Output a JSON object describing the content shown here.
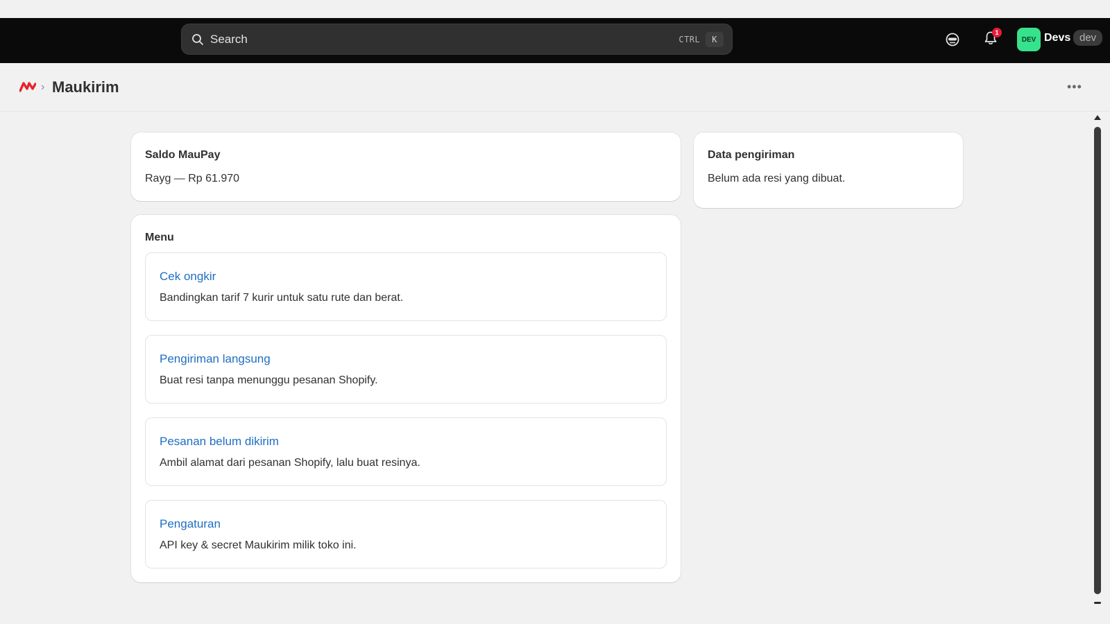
{
  "search": {
    "label": "Search",
    "shortcut_mod": "CTRL",
    "shortcut_key": "K"
  },
  "topbar": {
    "notification_count": "1",
    "avatar_initials": "DEV",
    "store_name": "Devs",
    "store_badge": "dev"
  },
  "app": {
    "title": "Maukirim",
    "breadcrumb_separator": "›",
    "more_menu": "•••"
  },
  "saldo": {
    "title": "Saldo MauPay",
    "value": "Rayg — Rp 61.970"
  },
  "shipping_data": {
    "title": "Data pengiriman",
    "text": "Belum ada resi yang dibuat."
  },
  "menu": {
    "title": "Menu",
    "items": [
      {
        "title": "Cek ongkir",
        "desc": "Bandingkan tarif 7 kurir untuk satu rute dan berat."
      },
      {
        "title": "Pengiriman langsung",
        "desc": "Buat resi tanpa menunggu pesanan Shopify."
      },
      {
        "title": "Pesanan belum dikirim",
        "desc": "Ambil alamat dari pesanan Shopify, lalu buat resinya."
      },
      {
        "title": "Pengaturan",
        "desc": "API key & secret Maukirim milik toko ini."
      }
    ]
  },
  "colors": {
    "link": "#1f6ec2",
    "avatar_bg": "#36e28b",
    "badge_red": "#e51c3b",
    "logo_red": "#e8232d"
  }
}
